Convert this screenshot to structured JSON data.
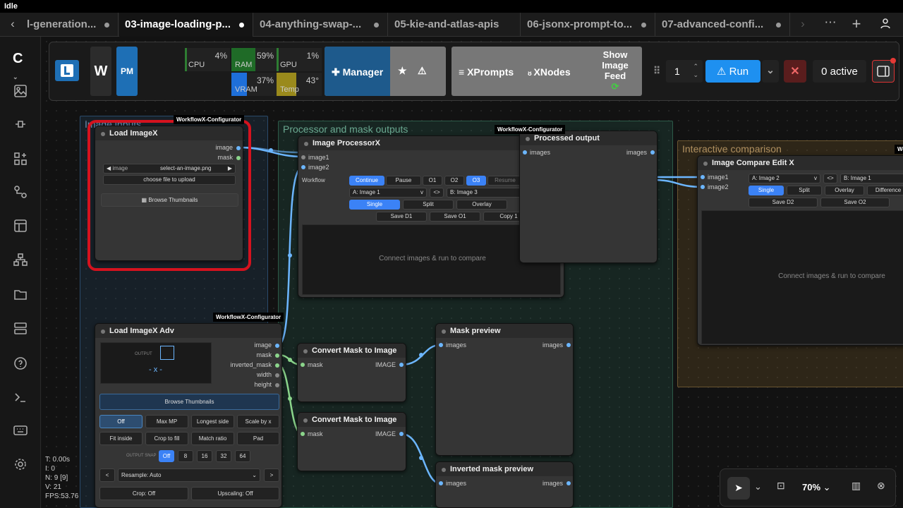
{
  "status": "Idle",
  "tabs": [
    {
      "label": "l-generation..."
    },
    {
      "label": "03-image-loading-p..."
    },
    {
      "label": "04-anything-swap-..."
    },
    {
      "label": "05-kie-and-atlas-apis"
    },
    {
      "label": "06-jsonx-prompt-to..."
    },
    {
      "label": "07-advanced-confi..."
    }
  ],
  "icons": {
    "back": "chevron-left-icon",
    "forward": "chevron-right-icon",
    "more": "more-dots-icon",
    "add": "plus-icon",
    "user": "user-icon"
  },
  "toolbar": {
    "w_label": "W",
    "pm_label": "PM",
    "metrics": [
      {
        "label": "CPU",
        "value": "4%",
        "color": "#2e7d32"
      },
      {
        "label": "RAM",
        "value": "59%",
        "color": "#2e7d32"
      },
      {
        "label": "GPU",
        "value": "1%",
        "color": "#2e7d32"
      },
      {
        "label": "VRAM",
        "value": "37%",
        "color": "#1e6fd9"
      },
      {
        "label": "Temp",
        "value": "43°",
        "color": "#9a8a1c"
      }
    ],
    "manager": "Manager",
    "xprompts": "XPrompts",
    "xnodes": "XNodes",
    "show_image_feed": [
      "Show",
      "Image",
      "Feed"
    ],
    "queue_value": "1",
    "run": "Run",
    "active": "0 active"
  },
  "stats": [
    "T: 0.00s",
    "I: 0",
    "N: 9 [9]",
    "V: 21",
    "FPS:53.76"
  ],
  "groups": {
    "image_inputs": "Image inputs",
    "processor": "Processor and mask outputs",
    "interactive": "Interactive comparison"
  },
  "badge": "WorkflowX-Configurator",
  "nodes": {
    "load_image": {
      "title": "Load ImageX",
      "out_image": "image",
      "out_mask": "mask",
      "image_label": "image",
      "image_value": "select-an-image.png",
      "upload": "choose file to upload",
      "browse": "▦ Browse Thumbnails"
    },
    "processor": {
      "title": "Image ProcessorX",
      "in1": "image1",
      "in2": "image2",
      "workflow": "Workflow",
      "btns": [
        "Continue",
        "Pause",
        "O1",
        "O2",
        "O3",
        "Resume"
      ],
      "sel_a": "A: Image 1",
      "swap": "<>",
      "sel_b": "B: Image 3",
      "modes": [
        "Single",
        "Split",
        "Overlay"
      ],
      "saves": [
        "Save D1",
        "Save O1",
        "Copy 1"
      ],
      "placeholder": "Connect images & run to compare"
    },
    "processed_output": {
      "title": "Processed output",
      "in": "images",
      "out": "images"
    },
    "compare": {
      "title": "Image Compare Edit X",
      "in1": "image1",
      "in2": "image2",
      "sel_a": "A: Image 2",
      "swap": "<>",
      "sel_b": "B: Image 1",
      "modes": [
        "Single",
        "Split",
        "Overlay",
        "Difference"
      ],
      "saves": [
        "Save D2",
        "Save O2"
      ],
      "placeholder": "Connect images & run to compare"
    },
    "load_adv": {
      "title": "Load ImageX Adv",
      "output": "OUTPUT",
      "dims": "- x -",
      "outs": [
        "image",
        "mask",
        "inverted_mask",
        "width",
        "height"
      ],
      "browse": "Browse Thumbnails",
      "opts1": [
        "Off",
        "Max MP",
        "Longest side",
        "Scale by x"
      ],
      "opts2": [
        "Fit inside",
        "Crop to fill",
        "Match ratio",
        "Pad"
      ],
      "snap_label": "OUTPUT SNAP",
      "snaps": [
        "Off",
        "8",
        "16",
        "32",
        "64"
      ],
      "resample": "Resample: Auto",
      "crop": "Crop: Off",
      "upscaling": "Upscaling: Off"
    },
    "convert1": {
      "title": "Convert Mask to Image",
      "in": "mask",
      "out": "IMAGE"
    },
    "convert2": {
      "title": "Convert Mask to Image",
      "in": "mask",
      "out": "IMAGE"
    },
    "mask_preview": {
      "title": "Mask preview",
      "in": "images",
      "out": "images"
    },
    "inv_preview": {
      "title": "Inverted mask preview",
      "in": "images",
      "out": "images"
    }
  },
  "bottom": {
    "zoom": "70%"
  }
}
